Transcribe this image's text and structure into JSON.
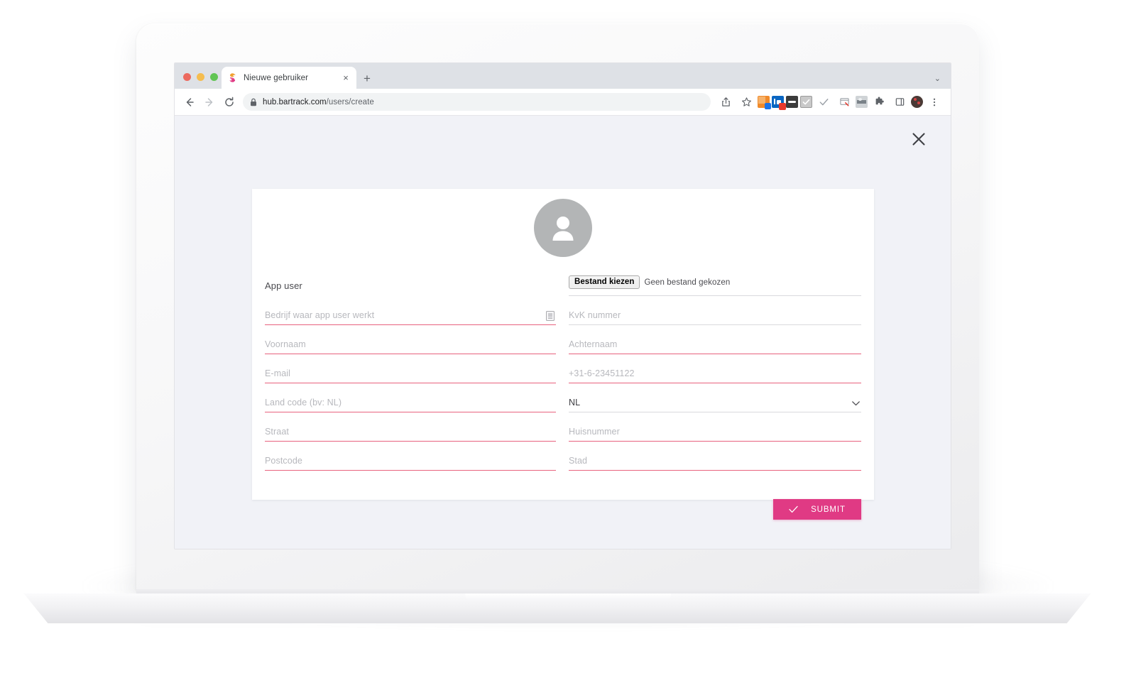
{
  "browser": {
    "tab": {
      "title": "Nieuwe gebruiker",
      "close_label": "×",
      "favicon": "bartrack-logo-icon"
    },
    "new_tab_label": "+",
    "tabstrip_chevron": "⌄",
    "nav": {
      "back": "←",
      "forward": "→",
      "reload": "⟳"
    },
    "omnibox": {
      "lock": "lock-icon",
      "host": "hub.bartrack.com",
      "path": "/users/create",
      "url_full": "hub.bartrack.com/users/create"
    },
    "toolbar_icons": [
      "share-icon",
      "bookmark-star-icon",
      "extension-orange-icon",
      "linkedin-extension-icon",
      "extension-dark-icon",
      "extension-checkbox-icon",
      "checkmark-icon",
      "extension-window-icon",
      "extension-photo-icon",
      "extensions-puzzle-icon",
      "side-panel-icon",
      "profile-avatar-icon",
      "menu-kebab-icon"
    ]
  },
  "page": {
    "close_button": "✕",
    "avatar": "user-placeholder-icon",
    "section_label": "App user",
    "file_upload": {
      "button_label": "Bestand kiezen",
      "status_text": "Geen bestand gekozen"
    },
    "fields": [
      {
        "name": "company",
        "placeholder": "Bedrijf waar app user werkt",
        "value": "",
        "required": true,
        "trailing_icon": "business-card-icon"
      },
      {
        "name": "kvk",
        "placeholder": "KvK nummer",
        "value": "",
        "required": false,
        "trailing_icon": ""
      },
      {
        "name": "first-name",
        "placeholder": "Voornaam",
        "value": "",
        "required": true,
        "trailing_icon": ""
      },
      {
        "name": "last-name",
        "placeholder": "Achternaam",
        "value": "",
        "required": true,
        "trailing_icon": ""
      },
      {
        "name": "email",
        "placeholder": "E-mail",
        "value": "",
        "required": true,
        "trailing_icon": ""
      },
      {
        "name": "phone",
        "placeholder": "+31-6-23451122",
        "value": "",
        "required": true,
        "trailing_icon": ""
      },
      {
        "name": "country-code",
        "placeholder": "Land code (bv: NL)",
        "value": "",
        "required": true,
        "trailing_icon": ""
      },
      {
        "name": "country-select",
        "placeholder": "",
        "value": "NL",
        "required": false,
        "trailing_icon": "chevron-down-icon"
      },
      {
        "name": "street",
        "placeholder": "Straat",
        "value": "",
        "required": true,
        "trailing_icon": ""
      },
      {
        "name": "house-number",
        "placeholder": "Huisnummer",
        "value": "",
        "required": true,
        "trailing_icon": ""
      },
      {
        "name": "postcode",
        "placeholder": "Postcode",
        "value": "",
        "required": true,
        "trailing_icon": ""
      },
      {
        "name": "city",
        "placeholder": "Stad",
        "value": "",
        "required": true,
        "trailing_icon": ""
      }
    ],
    "submit": {
      "label": "SUBMIT",
      "icon": "check-icon"
    }
  },
  "colors": {
    "accent_pink": "#e03a84",
    "underline_required": "#e8627e",
    "underline_optional": "#d9d9dd",
    "page_background": "#f1f2f7",
    "card_background": "#ffffff",
    "avatar_gray": "#b3b5b6",
    "tabstrip_gray": "#dee1e6"
  }
}
